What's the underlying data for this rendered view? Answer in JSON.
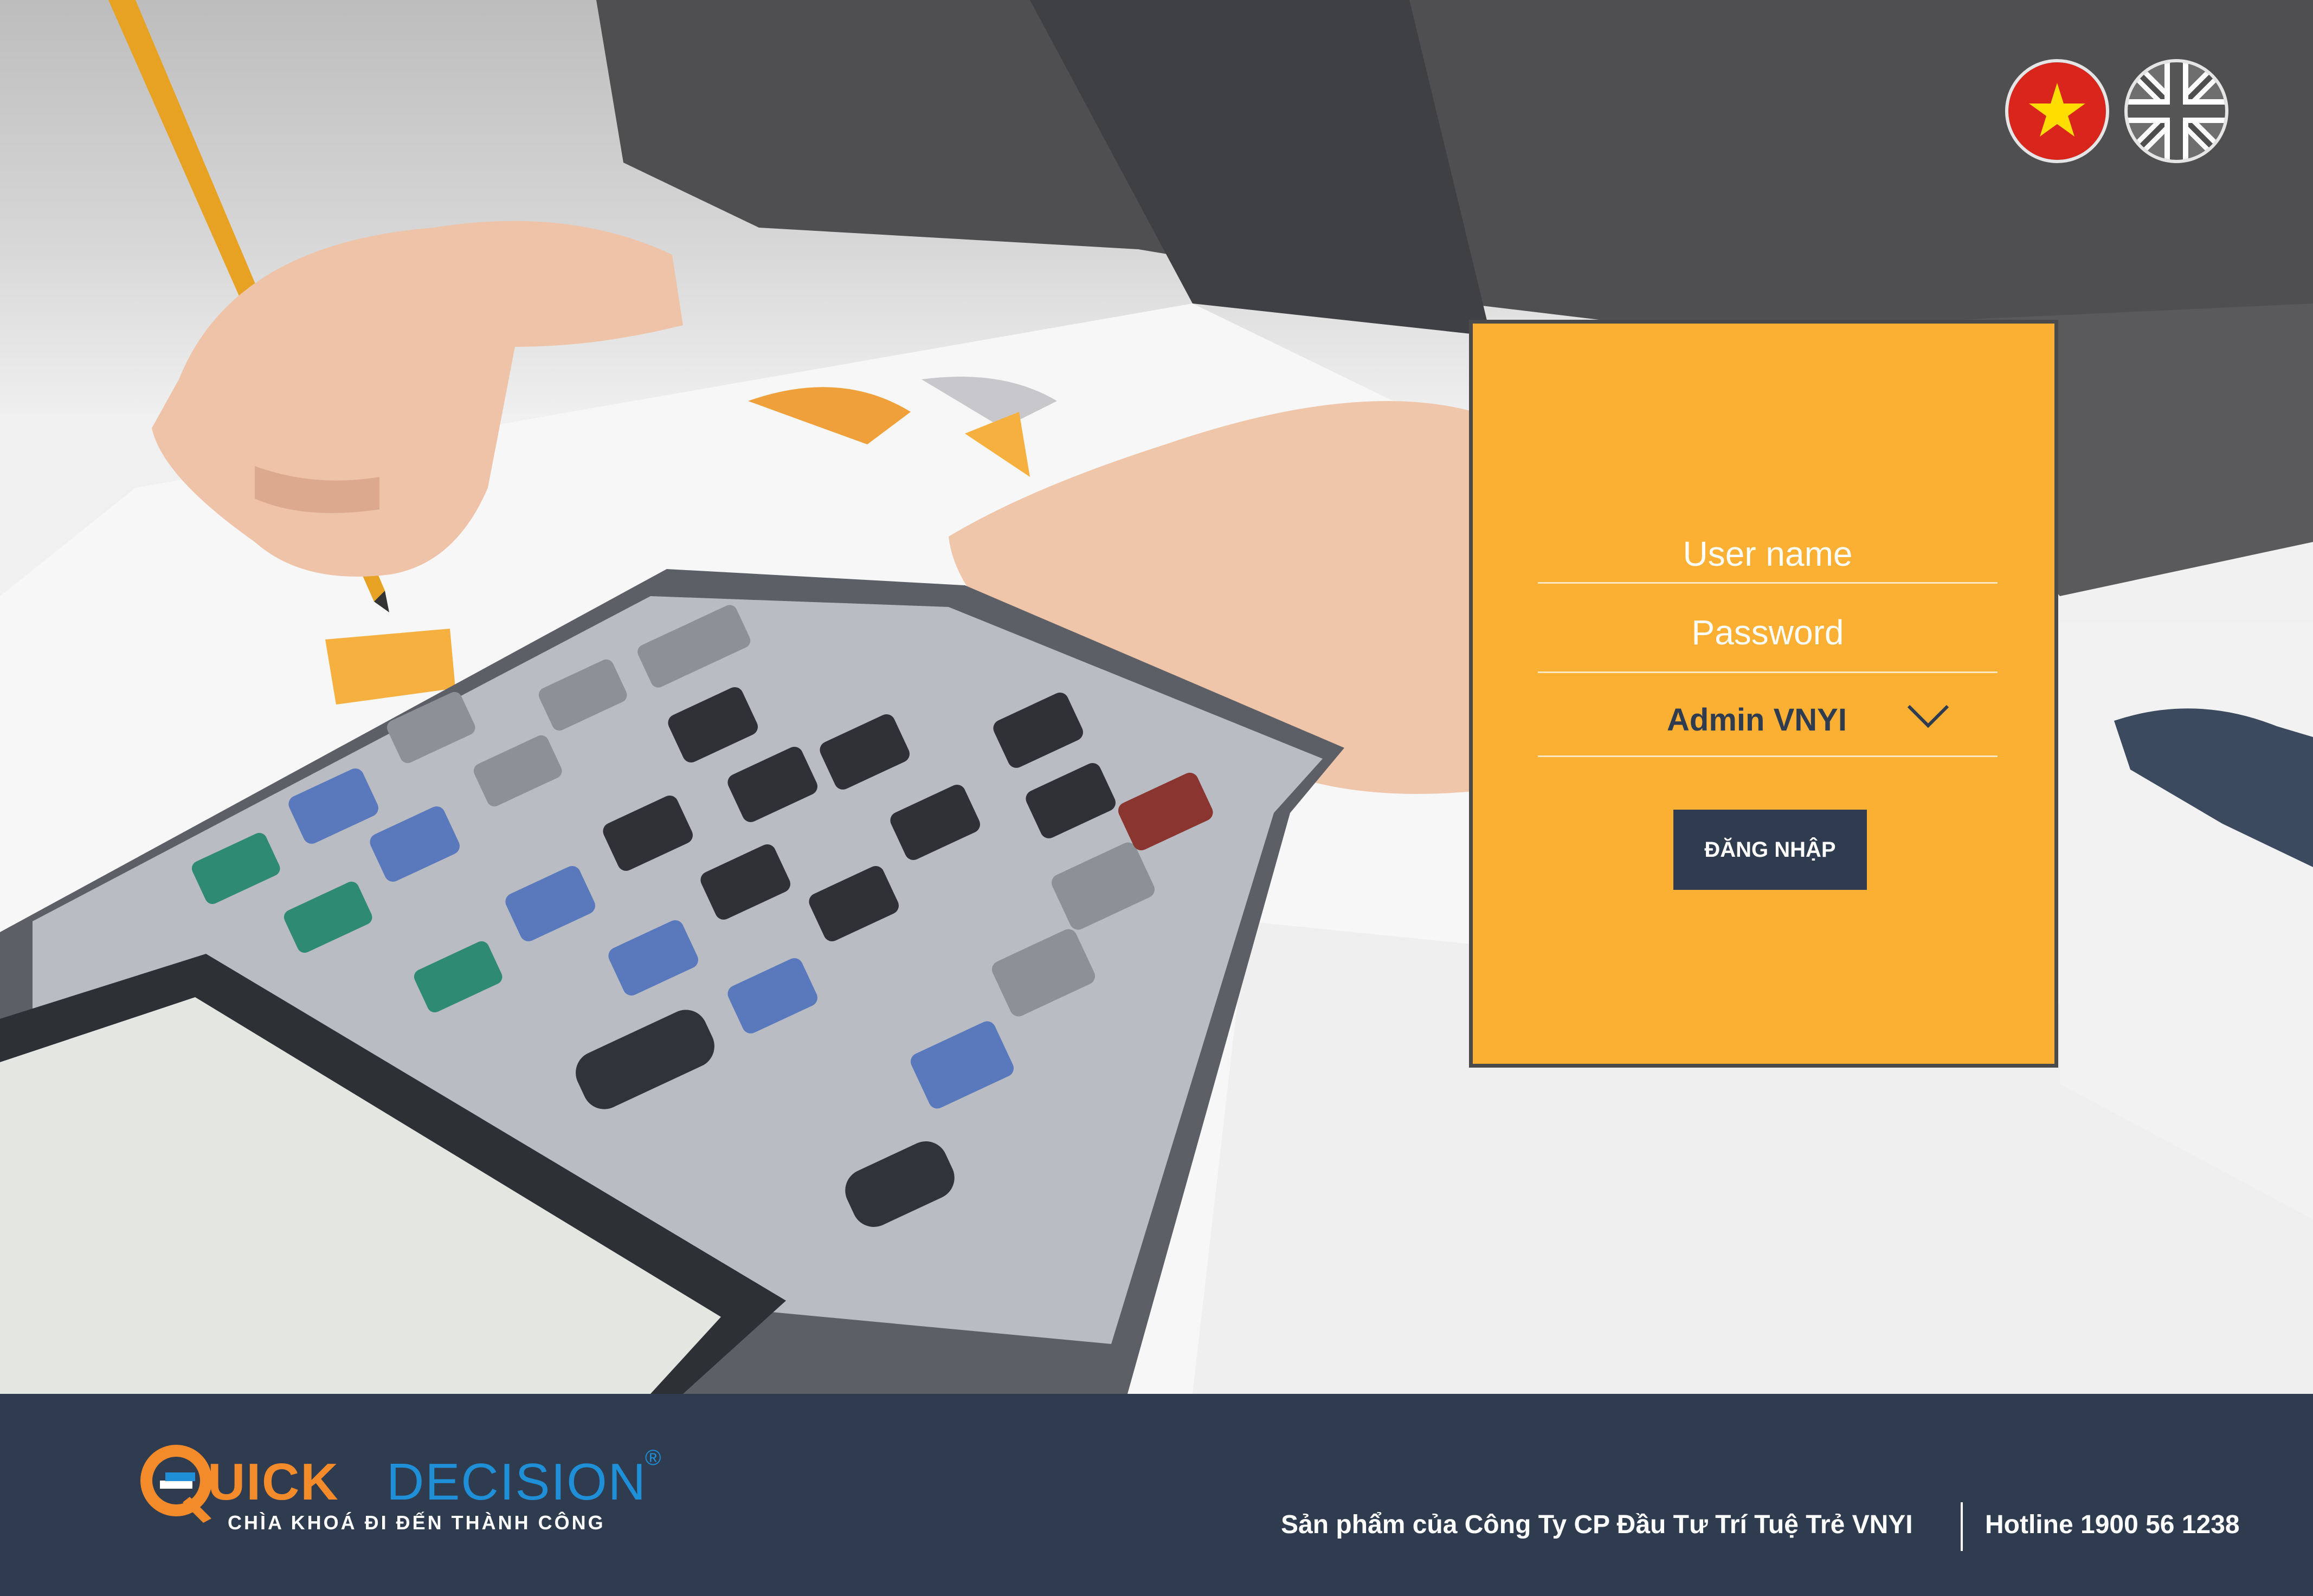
{
  "language_switcher": {
    "options": [
      {
        "name": "Tiếng Việt",
        "icon": "vietnam-flag-icon"
      },
      {
        "name": "English",
        "icon": "uk-flag-icon"
      }
    ]
  },
  "login": {
    "username_placeholder": "User name",
    "password_placeholder": "Password",
    "account_select_value": "Admin VNYI",
    "submit_label": "ĐĂNG NHẬP",
    "panel_color": "#fbb034",
    "button_color": "#2f3c4f"
  },
  "footer": {
    "logo": {
      "word1": "UICK",
      "word2": "DECISION",
      "registered_mark": "®",
      "tagline": "CHÌA KHOÁ ĐI ĐẾN THÀNH CÔNG",
      "orange": "#f38b2a",
      "blue": "#1f8fd8"
    },
    "company_text": "Sản phẩm của Công Ty CP Đầu Tư Trí Tuệ Trẻ VNYI",
    "hotline_text": "Hotline 1900 56 1238",
    "background_color": "#2f3c4f"
  }
}
